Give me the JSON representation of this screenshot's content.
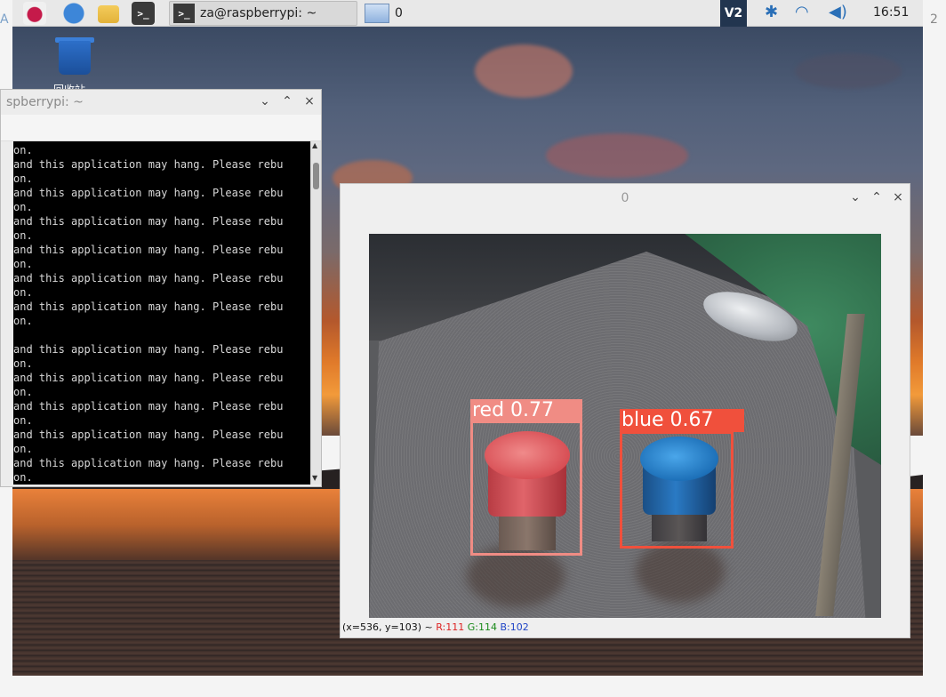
{
  "taskbar": {
    "terminal_task_label": "za@raspberrypi: ~",
    "window_task_label": "0",
    "terminal_icon_glyph": ">_",
    "vnc_label": "V2",
    "clock": "16:51",
    "icons": [
      "raspberry-menu-icon",
      "web-browser-icon",
      "file-manager-icon",
      "terminal-icon",
      "vnc-icon",
      "bluetooth-icon",
      "wifi-icon",
      "volume-icon"
    ]
  },
  "edges": {
    "left_char": "A",
    "right_char": "2"
  },
  "desktop": {
    "trash_label": "回收站"
  },
  "terminal": {
    "title": "spberrypi: ~",
    "lines": [
      "on.",
      "and this application may hang. Please rebu",
      "on.",
      "and this application may hang. Please rebu",
      "on.",
      "and this application may hang. Please rebu",
      "on.",
      "and this application may hang. Please rebu",
      "on.",
      "and this application may hang. Please rebu",
      "on.",
      "and this application may hang. Please rebu",
      "on.",
      "",
      "and this application may hang. Please rebu",
      "on.",
      "and this application may hang. Please rebu",
      "on.",
      "and this application may hang. Please rebu",
      "on.",
      "and this application may hang. Please rebu",
      "on.",
      "and this application may hang. Please rebu",
      "on."
    ]
  },
  "window_controls": {
    "minimize": "⌄",
    "maximize": "⌃",
    "close": "×"
  },
  "image_window": {
    "title": "0",
    "detections": [
      {
        "label": "red 0.77",
        "class": "red",
        "confidence": 0.77,
        "color": "#f08c84"
      },
      {
        "label": "blue 0.67",
        "class": "blue",
        "confidence": 0.67,
        "color": "#f0503c"
      }
    ],
    "status": {
      "coords": "(x=536, y=103) ~",
      "r": "R:111",
      "g": "G:114",
      "b": "B:102"
    }
  }
}
